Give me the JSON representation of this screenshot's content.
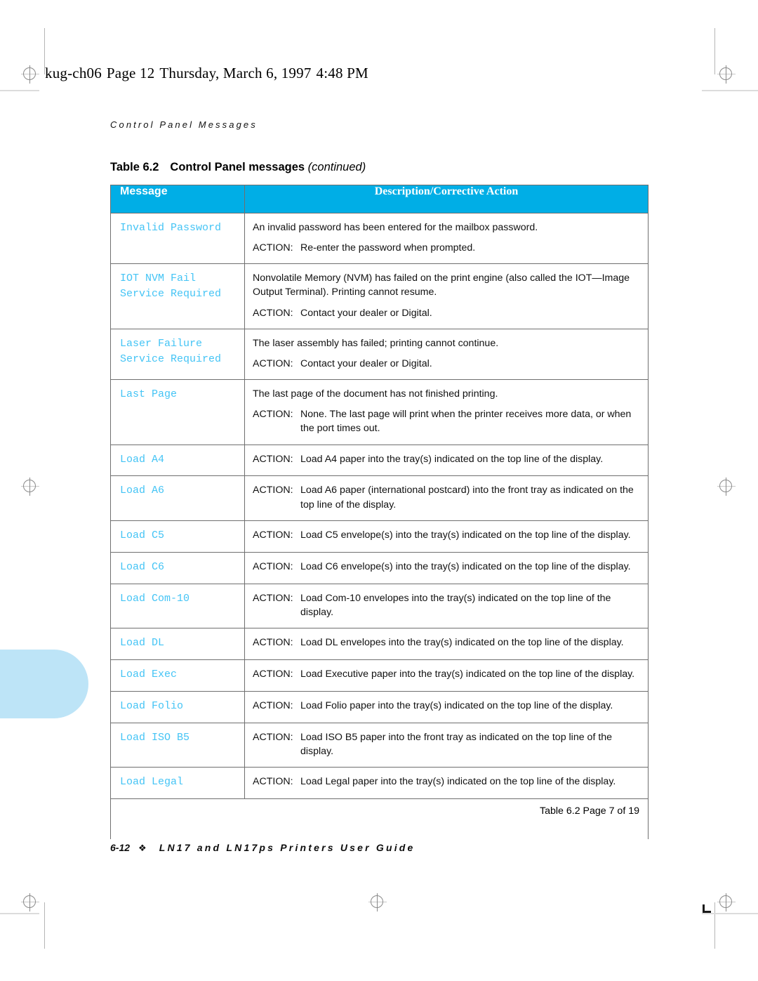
{
  "file_header": {
    "filename": "kug-ch06",
    "page_label": "Page 12",
    "day": "Thursday, March 6, 1997",
    "time": "4:48 PM"
  },
  "running_head": "Control Panel Messages",
  "caption": {
    "number": "Table 6.2",
    "title": "Control Panel messages",
    "continued": "(continued)"
  },
  "colors": {
    "header_cyan": "#00AEE6",
    "message_blue": "#44C4F5",
    "tab_blue": "#BDE4F7"
  },
  "table": {
    "columns": [
      "Message",
      "Description/Corrective Action"
    ],
    "action_label": "ACTION:",
    "rows": [
      {
        "message": "Invalid Password",
        "description": "An invalid password has been entered for the mailbox password.",
        "action": "Re-enter the password when prompted."
      },
      {
        "message": "IOT NVM Fail\nService Required",
        "description": "Nonvolatile Memory (NVM) has failed on the print engine (also called the IOT—Image Output Terminal). Printing cannot resume.",
        "action": "Contact your dealer or Digital."
      },
      {
        "message": "Laser Failure\nService Required",
        "description": "The laser assembly has failed; printing cannot continue.",
        "action": "Contact your dealer or Digital."
      },
      {
        "message": "Last Page",
        "description": "The last page of the document has not finished printing.",
        "action": "None. The last page will print when the printer receives more data, or when the port times out."
      },
      {
        "message": "Load A4",
        "description": "",
        "action": "Load A4 paper into the tray(s) indicated on the top line of the display."
      },
      {
        "message": "Load A6",
        "description": "",
        "action": "Load A6 paper (international postcard) into the front tray as indicated on the top line of the display."
      },
      {
        "message": "Load C5",
        "description": "",
        "action": "Load C5 envelope(s) into the tray(s) indicated on the top line of the display."
      },
      {
        "message": "Load C6",
        "description": "",
        "action": "Load C6 envelope(s) into the tray(s) indicated on the top line of the display."
      },
      {
        "message": "Load Com-10",
        "description": "",
        "action": "Load Com-10 envelopes into the tray(s) indicated on the top line of the display."
      },
      {
        "message": "Load DL",
        "description": "",
        "action": "Load DL envelopes into the tray(s) indicated on the top line of the display."
      },
      {
        "message": "Load Exec",
        "description": "",
        "action": "Load Executive paper into the tray(s) indicated on the top line of the display."
      },
      {
        "message": "Load Folio",
        "description": "",
        "action": "Load Folio paper into the tray(s) indicated on the top line of the display."
      },
      {
        "message": "Load ISO B5",
        "description": "",
        "action": "Load ISO B5 paper into the front tray as indicated on the top line of the display."
      },
      {
        "message": "Load Legal",
        "description": "",
        "action": "Load Legal paper into the tray(s) indicated on the top line of the display."
      }
    ],
    "footer_note": "Table 6.2  Page 7 of 19"
  },
  "page_footer": {
    "folio": "6-12",
    "diamond": "❖",
    "guide": "LN17 and LN17ps Printers User Guide"
  }
}
